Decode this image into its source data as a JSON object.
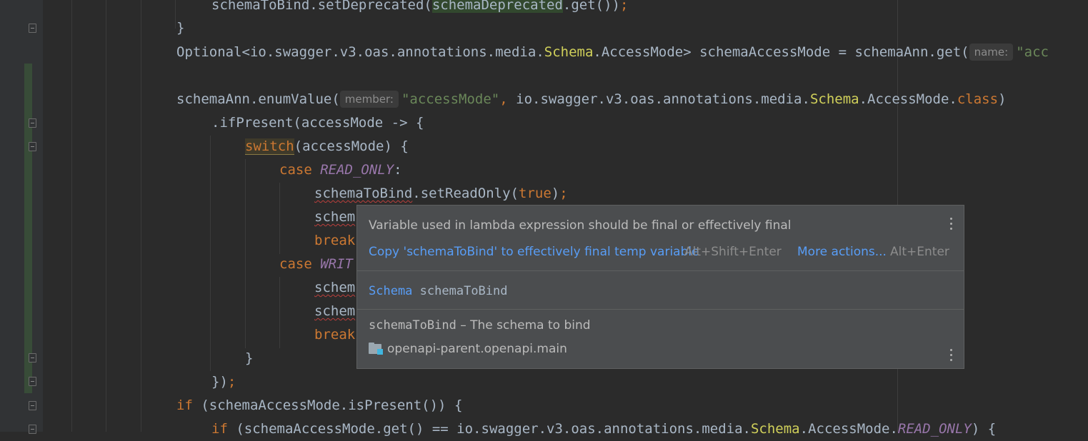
{
  "editor": {
    "lines": {
      "l0_a": "schemaToBind.setDeprecated(",
      "l0_b": "schemaDeprecated",
      "l0_c": ".get())",
      "l0_d": ";",
      "l1": "}",
      "l2_a": "Optional<io.swagger.v3.oas.annotations.media.",
      "l2_b": "Schema",
      "l2_c": ".AccessMode> schemaAccessMode = schemaAnn.get(",
      "l2_hint": "name:",
      "l2_d": "\"acc",
      "l4_a": "schemaAnn.enumValue(",
      "l4_hint": "member:",
      "l4_b": "\"accessMode\"",
      "l4_c": ",",
      "l4_d": " io.swagger.v3.oas.annotations.media.",
      "l4_e": "Schema",
      "l4_f": ".AccessMode.",
      "l4_g": "class",
      "l4_h": ")",
      "l5": ".ifPresent(accessMode -> {",
      "l6_a": "switch",
      "l6_b": "(accessMode) {",
      "l7_a": "case ",
      "l7_b": "READ_ONLY",
      "l7_c": ":",
      "l8_a": "schemaToBind",
      "l8_b": ".setReadOnly(",
      "l8_c": "true",
      "l8_d": ")",
      "l8_e": ";",
      "l9": "schem",
      "l10": "break",
      "l11_a": "case ",
      "l11_b": "WRIT",
      "l12": "schem",
      "l13": "schem",
      "l14": "break",
      "l15": "}",
      "l16_a": "})",
      "l16_b": ";",
      "l17_a": "if",
      "l17_b": " (schemaAccessMode.isPresent()) {",
      "l18_a": "if",
      "l18_b": " (schemaAccessMode.get() == io.swagger.v3.oas.annotations.media.",
      "l18_c": "Schema",
      "l18_d": ".AccessMode.",
      "l18_e": "READ_ONLY",
      "l18_f": ") {"
    }
  },
  "popup": {
    "message": "Variable used in lambda expression should be final or effectively final",
    "fix_label": "Copy 'schemaToBind' to effectively final temp variable",
    "fix_shortcut": "Alt+Shift+Enter",
    "more_label": "More actions...",
    "more_shortcut": "Alt+Enter",
    "decl_type": "Schema",
    "decl_name": "schemaToBind",
    "doc_name": "schemaToBind",
    "doc_text": " – The schema to bind",
    "module": "openapi-parent.openapi.main",
    "module_icon": "module-folder-icon"
  },
  "colors": {
    "background": "#2b2b2b",
    "keyword": "#cc7832",
    "string": "#6a8759",
    "link": "#589df6",
    "error_underline": "#bc3f3c"
  }
}
